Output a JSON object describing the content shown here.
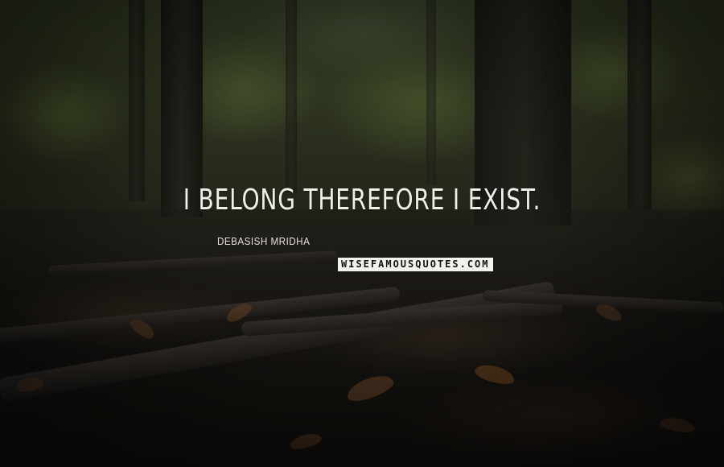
{
  "quote": {
    "text": "I belong therefore I exist.",
    "author": "Debasish Mridha"
  },
  "watermark": {
    "text": "wisefamousquotes.com"
  },
  "background": {
    "description_icon": "forest-floor-photo",
    "palette": [
      "#3f4a2c",
      "#2b2a22",
      "#171512",
      "#5e3f26"
    ]
  }
}
